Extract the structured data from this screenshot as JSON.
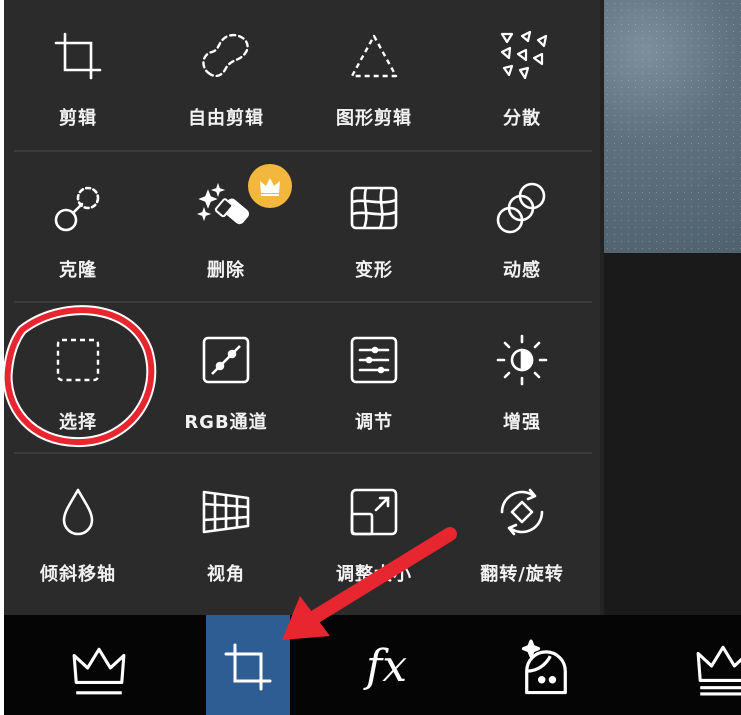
{
  "tools": {
    "row1": [
      {
        "label": "剪辑",
        "icon": "crop-icon"
      },
      {
        "label": "自由剪辑",
        "icon": "freeform-crop-icon"
      },
      {
        "label": "图形剪辑",
        "icon": "shape-crop-icon"
      },
      {
        "label": "分散",
        "icon": "dispersion-icon"
      }
    ],
    "row2": [
      {
        "label": "克隆",
        "icon": "clone-icon"
      },
      {
        "label": "删除",
        "icon": "remove-icon",
        "premium": true
      },
      {
        "label": "变形",
        "icon": "warp-icon"
      },
      {
        "label": "动感",
        "icon": "motion-icon"
      }
    ],
    "row3": [
      {
        "label": "选择",
        "icon": "select-icon"
      },
      {
        "label": "RGB通道",
        "icon": "rgb-curves-icon"
      },
      {
        "label": "调节",
        "icon": "adjust-icon"
      },
      {
        "label": "增强",
        "icon": "enhance-icon"
      }
    ],
    "row4": [
      {
        "label": "倾斜移轴",
        "icon": "tilt-shift-icon"
      },
      {
        "label": "视角",
        "icon": "perspective-icon"
      },
      {
        "label": "调整大小",
        "icon": "resize-icon"
      },
      {
        "label": "翻转/旋转",
        "icon": "flip-rotate-icon"
      }
    ]
  },
  "bottom_tabs": [
    {
      "name": "premium-crown-tab",
      "icon": "crown-icon"
    },
    {
      "name": "tools-tab",
      "icon": "crop-icon",
      "active": true
    },
    {
      "name": "effects-tab",
      "icon": "fx-icon",
      "label": "fx"
    },
    {
      "name": "beautify-tab",
      "icon": "face-sparkle-icon"
    },
    {
      "name": "crown-tab",
      "icon": "crown-icon"
    }
  ],
  "colors": {
    "panel": "#2b2b2b",
    "active_tab": "#2d5d93",
    "premium_badge": "#f3b73d",
    "annotation_red": "#e8262f"
  }
}
